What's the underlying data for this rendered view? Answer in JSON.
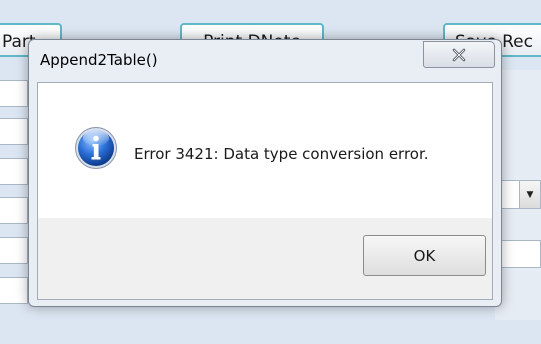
{
  "background_app": {
    "buttons": [
      "Part",
      "Print DNote",
      "Save Rec"
    ],
    "combo_arrow_icon": "chevron-down-icon"
  },
  "dialog": {
    "title": "Append2Table()",
    "close_icon": "close-icon",
    "message_icon": "info-icon",
    "message": "Error 3421: Data type conversion error.",
    "ok_label": "OK"
  },
  "colors": {
    "app_background": "#dce6f2",
    "button_border": "#5fb7c7",
    "dialog_frame": "#e9eef5",
    "info_icon_blue": "#1f5fbf"
  }
}
